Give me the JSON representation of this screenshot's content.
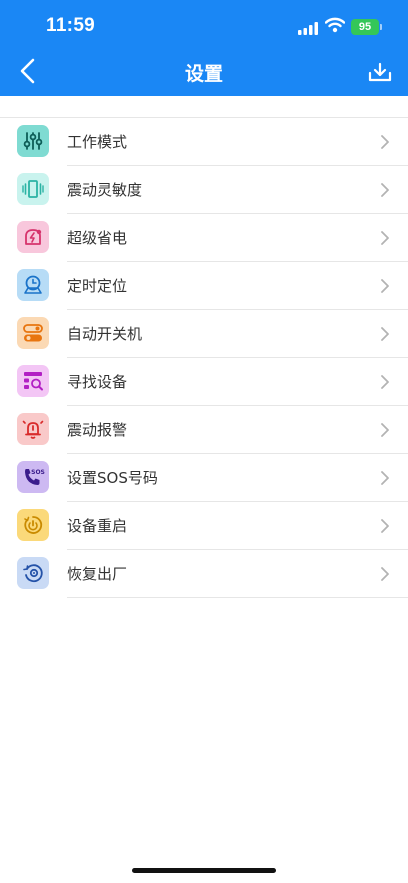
{
  "status_bar": {
    "time": "11:59",
    "battery": "95"
  },
  "header": {
    "title": "设置"
  },
  "colors": {
    "header_bg": "#1a87f5"
  },
  "menu": [
    {
      "label": "工作模式",
      "icon": "sliders-icon",
      "icon_bg": "#7fdbd2"
    },
    {
      "label": "震动灵敏度",
      "icon": "vibration-icon",
      "icon_bg": "#c9f3ee"
    },
    {
      "label": "超级省电",
      "icon": "power-saving-icon",
      "icon_bg": "#f8c7dc"
    },
    {
      "label": "定时定位",
      "icon": "timed-location-icon",
      "icon_bg": "#b7dcf6"
    },
    {
      "label": "自动开关机",
      "icon": "toggle-icon",
      "icon_bg": "#fbd9b4"
    },
    {
      "label": "寻找设备",
      "icon": "find-device-icon",
      "icon_bg": "#f3c6f5"
    },
    {
      "label": "震动报警",
      "icon": "alarm-bell-icon",
      "icon_bg": "#f9c9c9"
    },
    {
      "label": "设置SOS号码",
      "icon": "sos-phone-icon",
      "icon_bg": "#cdb9f2"
    },
    {
      "label": "设备重启",
      "icon": "restart-icon",
      "icon_bg": "#fbd97a"
    },
    {
      "label": "恢复出厂",
      "icon": "factory-reset-icon",
      "icon_bg": "#c9daf5"
    }
  ]
}
